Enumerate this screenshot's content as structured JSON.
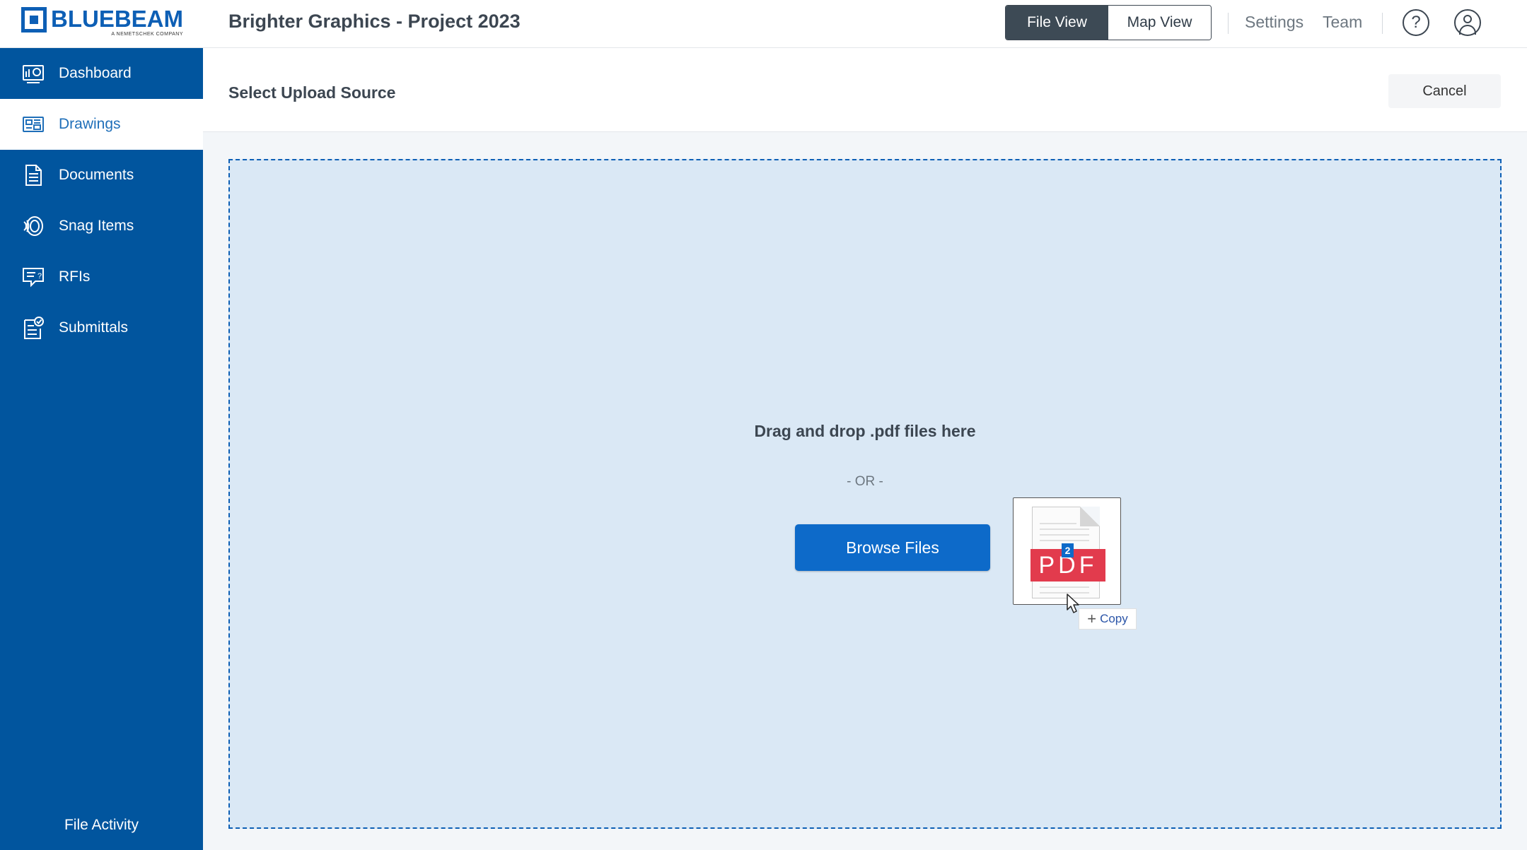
{
  "header": {
    "logo_text": "BLUEBEAM",
    "logo_subtext": "A NEMETSCHEK COMPANY",
    "project_title": "Brighter Graphics - Project 2023",
    "view_toggle": {
      "file_view": "File View",
      "map_view": "Map View",
      "active": "file_view"
    },
    "links": {
      "settings": "Settings",
      "team": "Team"
    },
    "help_icon": "?"
  },
  "sidebar": {
    "items": [
      {
        "label": "Dashboard",
        "icon": "dashboard-icon"
      },
      {
        "label": "Drawings",
        "icon": "drawings-icon",
        "active": true
      },
      {
        "label": "Documents",
        "icon": "documents-icon"
      },
      {
        "label": "Snag Items",
        "icon": "snag-items-icon"
      },
      {
        "label": "RFIs",
        "icon": "rfis-icon"
      },
      {
        "label": "Submittals",
        "icon": "submittals-icon"
      }
    ],
    "footer_link": "File Activity"
  },
  "main": {
    "section_title": "Select Upload Source",
    "cancel_label": "Cancel",
    "dropzone": {
      "prompt": "Drag and drop .pdf files here",
      "or_text": "- OR -",
      "browse_label": "Browse Files",
      "drag_preview": {
        "file_type_label": "PDF",
        "file_count": "2",
        "copy_label": "Copy"
      }
    }
  },
  "colors": {
    "brand_blue": "#01559e",
    "primary_button": "#0d6ac9",
    "dropzone_bg": "#dae8f5",
    "pdf_red": "#e23b4d"
  }
}
